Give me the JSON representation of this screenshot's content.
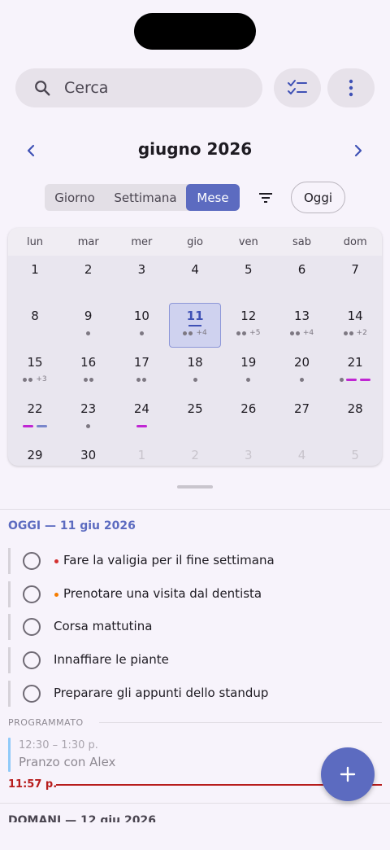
{
  "search": {
    "placeholder": "Cerca"
  },
  "month_nav": {
    "title": "giugno 2026"
  },
  "view_switch": {
    "day": "Giorno",
    "week": "Settimana",
    "month": "Mese",
    "selected": "Mese"
  },
  "today_button": "Oggi",
  "calendar": {
    "weekdays": [
      "lun",
      "mar",
      "mer",
      "gio",
      "ven",
      "sab",
      "dom"
    ],
    "weeks": [
      [
        {
          "d": "1"
        },
        {
          "d": "2"
        },
        {
          "d": "3"
        },
        {
          "d": "4"
        },
        {
          "d": "5"
        },
        {
          "d": "6"
        },
        {
          "d": "7"
        }
      ],
      [
        {
          "d": "8"
        },
        {
          "d": "9",
          "dots": 1
        },
        {
          "d": "10",
          "dots": 1
        },
        {
          "d": "11",
          "dots": 2,
          "more": "+4",
          "today": true
        },
        {
          "d": "12",
          "dots": 2,
          "more": "+5"
        },
        {
          "d": "13",
          "dots": 2,
          "more": "+4"
        },
        {
          "d": "14",
          "dots": 2,
          "more": "+2"
        }
      ],
      [
        {
          "d": "15",
          "dots": 2,
          "more": "+3"
        },
        {
          "d": "16",
          "dots": 2
        },
        {
          "d": "17",
          "dots": 2
        },
        {
          "d": "18",
          "dots": 1
        },
        {
          "d": "19",
          "dots": 1
        },
        {
          "d": "20",
          "dots": 1
        },
        {
          "d": "21",
          "dots": 1,
          "bars": [
            "#c026d3",
            "#c026d3"
          ]
        }
      ],
      [
        {
          "d": "22",
          "bars": [
            "#c026d3",
            "#7986cb"
          ]
        },
        {
          "d": "23",
          "dots": 1
        },
        {
          "d": "24",
          "bars": [
            "#c026d3"
          ]
        },
        {
          "d": "25"
        },
        {
          "d": "26"
        },
        {
          "d": "27"
        },
        {
          "d": "28"
        }
      ],
      [
        {
          "d": "29"
        },
        {
          "d": "30"
        },
        {
          "d": "1",
          "muted": true
        },
        {
          "d": "2",
          "muted": true
        },
        {
          "d": "3",
          "muted": true
        },
        {
          "d": "4",
          "muted": true
        },
        {
          "d": "5",
          "muted": true
        }
      ]
    ]
  },
  "agenda": {
    "today_title": "OGGI — 11 giu 2026",
    "tasks": [
      {
        "text": "Fare la valigia per il fine settimana",
        "priority_color": "#d32f2f"
      },
      {
        "text": "Prenotare una visita dal dentista",
        "priority_color": "#f57c00"
      },
      {
        "text": "Corsa mattutina",
        "priority_color": ""
      },
      {
        "text": "Innaffiare le piante",
        "priority_color": ""
      },
      {
        "text": "Preparare gli appunti dello standup",
        "priority_color": ""
      }
    ],
    "scheduled_title": "PROGRAMMATO",
    "event": {
      "time": "12:30 – 1:30 p.",
      "name": "Pranzo con Alex",
      "color": "#90caf9"
    },
    "now_time": "11:57 p.",
    "next_title": "DOMANI — 12 giu 2026"
  },
  "colors": {
    "accent": "#5c6bc0",
    "now_line": "#b71c1c"
  }
}
